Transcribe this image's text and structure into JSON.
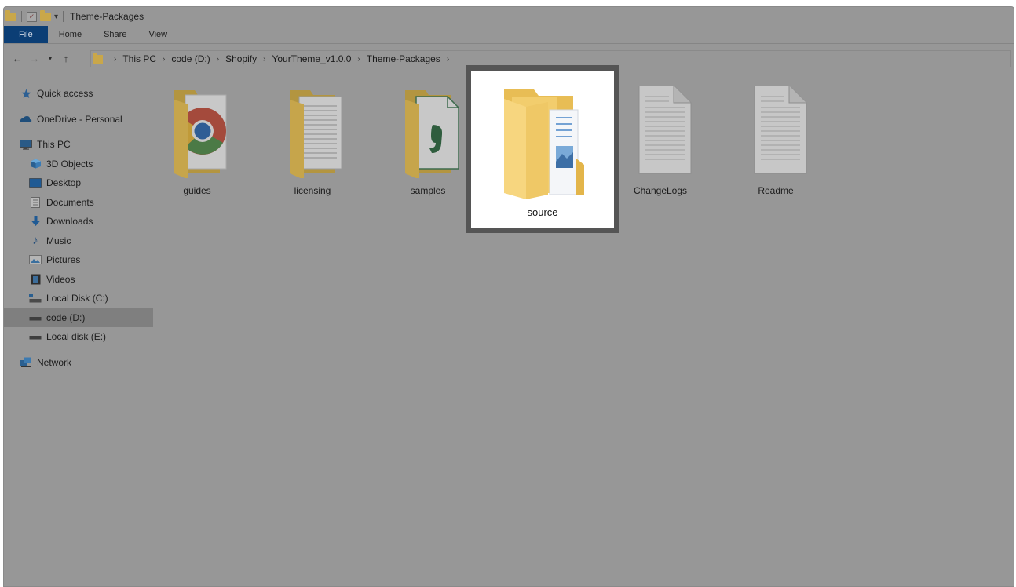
{
  "window": {
    "title": "Theme-Packages"
  },
  "ribbon": {
    "tabs": [
      "File",
      "Home",
      "Share",
      "View"
    ]
  },
  "address_bar": {
    "crumbs": [
      "This PC",
      "code (D:)",
      "Shopify",
      "YourTheme_v1.0.0",
      "Theme-Packages"
    ]
  },
  "nav_pane": {
    "quick_access": "Quick access",
    "onedrive": "OneDrive - Personal",
    "this_pc": "This PC",
    "children": [
      "3D Objects",
      "Desktop",
      "Documents",
      "Downloads",
      "Music",
      "Pictures",
      "Videos",
      "Local Disk (C:)",
      "code (D:)",
      "Local disk (E:)"
    ],
    "network": "Network",
    "selected": "code (D:)"
  },
  "files": [
    {
      "name": "guides",
      "type": "folder",
      "icon": "chrome-icon"
    },
    {
      "name": "licensing",
      "type": "folder",
      "icon": "document-icon"
    },
    {
      "name": "samples",
      "type": "folder",
      "icon": "spreadsheet-icon"
    },
    {
      "name": "source",
      "type": "folder",
      "icon": "folder-open-icon",
      "highlighted": true
    },
    {
      "name": "ChangeLogs",
      "type": "file",
      "icon": "text-file-icon"
    },
    {
      "name": "Readme",
      "type": "file",
      "icon": "text-file-icon"
    }
  ],
  "colors": {
    "overlay": "#979797",
    "file_tab": "#0b3e75",
    "folder": "#c9a74a",
    "folder_highlight": "#f5d47f",
    "highlight_border": "#555555"
  }
}
